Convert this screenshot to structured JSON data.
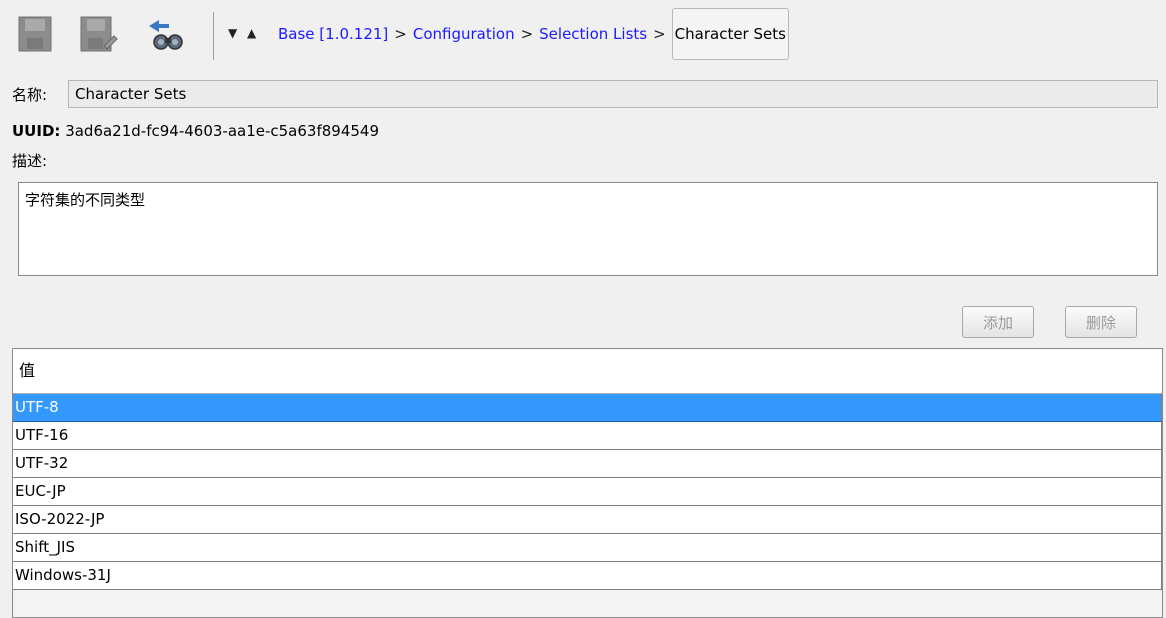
{
  "toolbar": {
    "icons": [
      "save-icon",
      "save-as-icon",
      "find-references-icon"
    ],
    "nav_arrows": "▼ ▲"
  },
  "breadcrumb": {
    "items": [
      "Base [1.0.121]",
      "Configuration",
      "Selection Lists"
    ],
    "separator": ">",
    "current": "Character Sets"
  },
  "form": {
    "name_label": "名称:",
    "name_value": "Character Sets",
    "uuid_label": "UUID:",
    "uuid_value": "3ad6a21d-fc94-4603-aa1e-c5a63f894549",
    "description_label": "描述:",
    "description_value": "字符集的不同类型"
  },
  "buttons": {
    "add_label": "添加",
    "delete_label": "删除"
  },
  "table": {
    "header": "值",
    "rows": [
      "UTF-8",
      "UTF-16",
      "UTF-32",
      "EUC-JP",
      "ISO-2022-JP",
      "Shift_JIS",
      "Windows-31J"
    ],
    "selected_index": 0
  },
  "colors": {
    "link": "#1a1aff",
    "selection": "#3399ff",
    "background": "#f0f0f0"
  }
}
